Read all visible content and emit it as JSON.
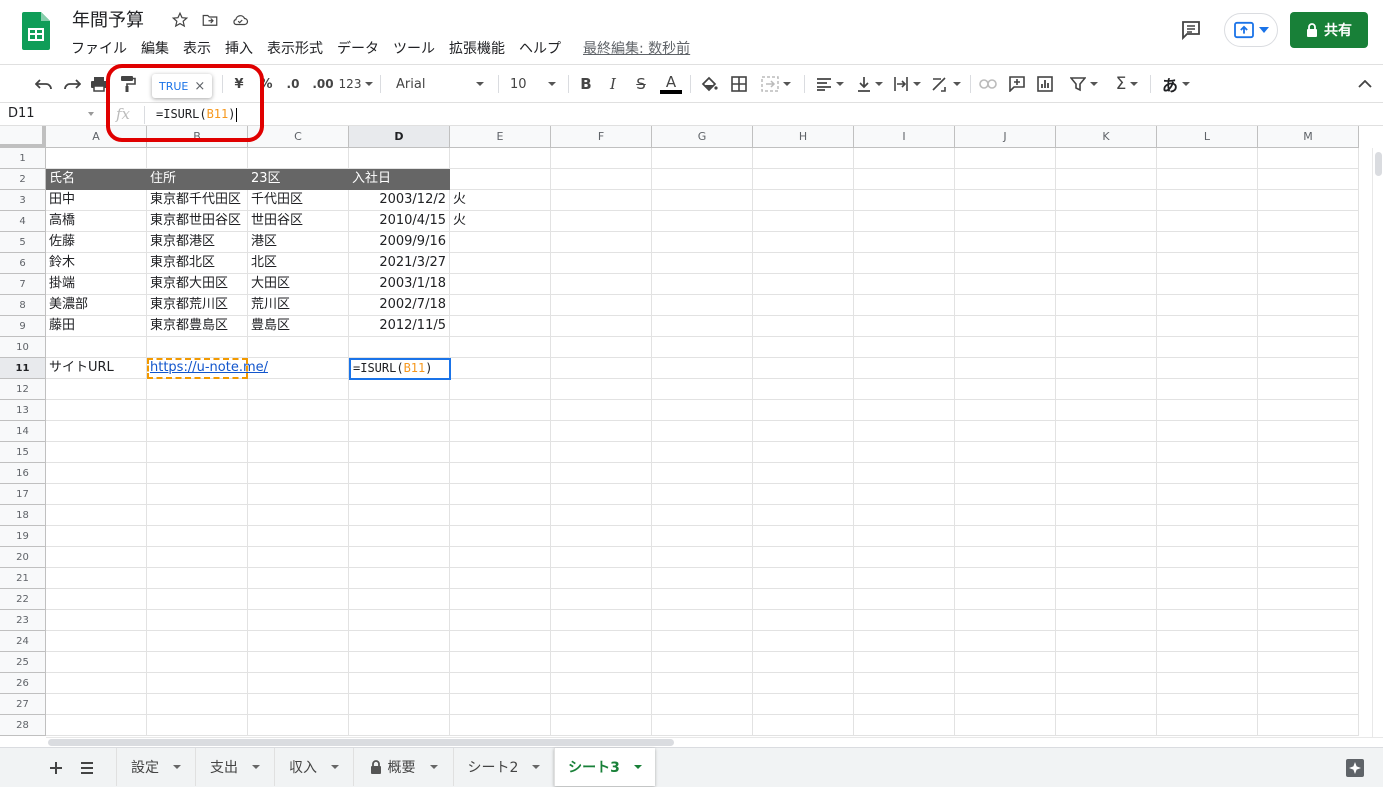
{
  "header": {
    "doc_title": "年間予算",
    "menu": [
      "ファイル",
      "編集",
      "表示",
      "挿入",
      "表示形式",
      "データ",
      "ツール",
      "拡張機能",
      "ヘルプ"
    ],
    "last_edit": "最終編集: 数秒前",
    "share_label": "共有"
  },
  "toolbar": {
    "currency": "¥",
    "percent": "%",
    "decimal_decrease": ".0",
    "decimal_increase": ".00",
    "format_more": "123",
    "font": "Arial",
    "font_size": "10",
    "bold": "B",
    "italic": "I",
    "strike": "S",
    "text_color_glyph": "A",
    "sum_glyph": "Σ",
    "input_tool": "あ",
    "text_color": "#000000"
  },
  "tooltip": {
    "value": "TRUE"
  },
  "formula_bar": {
    "cell_ref": "D11",
    "fx": "fx",
    "formula_prefix": "=ISURL(",
    "formula_ref": "B11",
    "formula_suffix": ")"
  },
  "grid": {
    "columns": [
      "A",
      "B",
      "C",
      "D",
      "E",
      "F",
      "G",
      "H",
      "I",
      "J",
      "K",
      "L",
      "M"
    ],
    "rows": [
      "1",
      "2",
      "3",
      "4",
      "5",
      "6",
      "7",
      "8",
      "9",
      "10",
      "11",
      "12",
      "13",
      "14",
      "15",
      "16",
      "17",
      "18",
      "19",
      "20",
      "21",
      "22",
      "23",
      "24",
      "25",
      "26",
      "27",
      "28"
    ],
    "table_header": [
      "氏名",
      "住所",
      "23区",
      "入社日"
    ],
    "table_rows": [
      [
        "田中",
        "東京都千代田区",
        "千代田区",
        "2003/12/2",
        "火"
      ],
      [
        "高橋",
        "東京都世田谷区",
        "世田谷区",
        "2010/4/15",
        "火"
      ],
      [
        "佐藤",
        "東京都港区",
        "港区",
        "2009/9/16",
        ""
      ],
      [
        "鈴木",
        "東京都北区",
        "北区",
        "2021/3/27",
        ""
      ],
      [
        "掛端",
        "東京都大田区",
        "大田区",
        "2003/1/18",
        ""
      ],
      [
        "美濃部",
        "東京都荒川区",
        "荒川区",
        "2002/7/18",
        ""
      ],
      [
        "藤田",
        "東京都豊島区",
        "豊島区",
        "2012/11/5",
        ""
      ]
    ],
    "row11": {
      "label": "サイトURL",
      "url": "https://u-note.me/",
      "formula_prefix": "=ISURL(",
      "formula_ref": "B11",
      "formula_suffix": ")"
    },
    "header_fill": "#666666"
  },
  "sheet_tabs": [
    "設定",
    "支出",
    "収入",
    "概要",
    "シート2",
    "シート3"
  ],
  "active_tab": "シート3",
  "colors": {
    "brand_green": "#188038",
    "selection_blue": "#1a73e8",
    "copy_orange": "#f29900",
    "highlight_red": "#e00000",
    "link_blue": "#1155cc"
  }
}
